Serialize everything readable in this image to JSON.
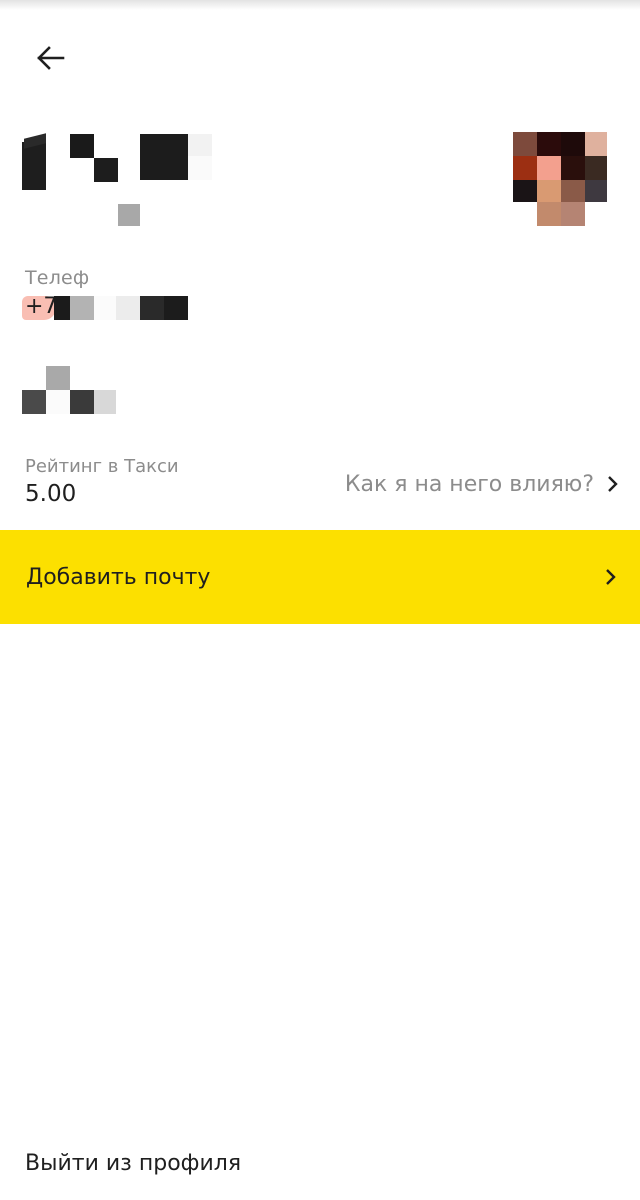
{
  "header": {
    "back_icon": "arrow-left-icon"
  },
  "profile": {
    "phone_label": "Телеф",
    "phone_prefix": "+7",
    "rating_label": "Рейтинг в Такси",
    "rating_value": "5.00",
    "rating_link_label": "Как я на него влияю?",
    "chevron_icon": "chevron-right-icon"
  },
  "actions": {
    "add_email_label": "Добавить почту",
    "logout_label": "Выйти из профиля"
  },
  "colors": {
    "accent_yellow": "#fce000",
    "secondary_text": "#8c8c8c",
    "primary_text": "#1f1f1f"
  }
}
